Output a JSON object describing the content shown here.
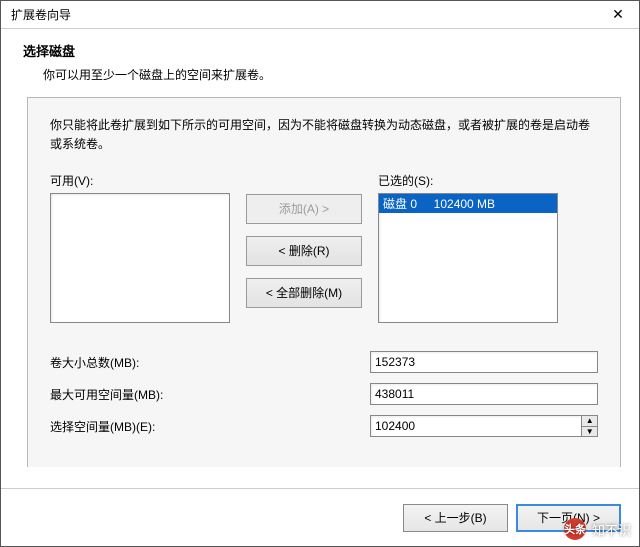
{
  "titlebar": {
    "title": "扩展卷向导",
    "close": "✕"
  },
  "header": {
    "title": "选择磁盘",
    "desc": "你可以用至少一个磁盘上的空间来扩展卷。"
  },
  "info_text": "你只能将此卷扩展到如下所示的可用空间，因为不能将磁盘转换为动态磁盘，或者被扩展的卷是启动卷或系统卷。",
  "lists": {
    "available_label": "可用(V):",
    "selected_label": "已选的(S):",
    "selected_item": "磁盘 0     102400 MB"
  },
  "buttons": {
    "add": "添加(A) >",
    "remove": "< 删除(R)",
    "remove_all": "< 全部删除(M)"
  },
  "fields": {
    "total_label": "卷大小总数(MB):",
    "total_value": "152373",
    "max_label": "最大可用空间量(MB):",
    "max_value": "438011",
    "select_label": "选择空间量(MB)(E):",
    "select_value": "102400"
  },
  "footer": {
    "back": "< 上一步(B)",
    "next": "下一页(N) >"
  },
  "watermark": {
    "logo": "头条",
    "text": "知不识"
  }
}
